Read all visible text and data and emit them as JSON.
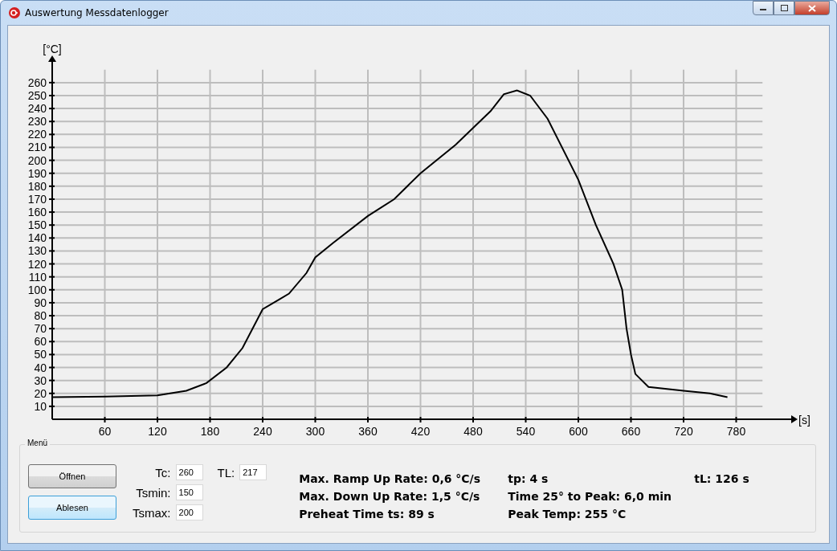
{
  "window": {
    "title": "Auswertung Messdatenlogger"
  },
  "chart": {
    "chart_data": {
      "type": "line",
      "grid": true,
      "xlabel": "[s]",
      "ylabel": "[°C]",
      "xlim": [
        0,
        810
      ],
      "ylim": [
        0,
        270
      ],
      "xticks": [
        60,
        120,
        180,
        240,
        300,
        360,
        420,
        480,
        540,
        600,
        660,
        720,
        780
      ],
      "yticks": [
        10,
        20,
        30,
        40,
        50,
        60,
        70,
        80,
        90,
        100,
        110,
        120,
        130,
        140,
        150,
        160,
        170,
        180,
        190,
        200,
        210,
        220,
        230,
        240,
        250,
        260
      ],
      "x": [
        0,
        60,
        120,
        153,
        176,
        199,
        217,
        240,
        260,
        270,
        290,
        300,
        320,
        360,
        390,
        420,
        460,
        480,
        500,
        515,
        530,
        545,
        565,
        600,
        620,
        640,
        650,
        655,
        660,
        665,
        680,
        720,
        750,
        770
      ],
      "series": [
        {
          "color": "#000000",
          "values": [
            17,
            17.5,
            18.5,
            22,
            28,
            40,
            55,
            85,
            93,
            97,
            113,
            125,
            136,
            157,
            170,
            190,
            212,
            225,
            238,
            251,
            254,
            250,
            232,
            185,
            150,
            120,
            100,
            70,
            50,
            35,
            25,
            22,
            20,
            17
          ]
        }
      ]
    }
  },
  "menu": {
    "title": "Menü",
    "buttons": [
      {
        "label": "Öffnen",
        "focused": false
      },
      {
        "label": "Ablesen",
        "focused": true
      }
    ],
    "field_columns": [
      [
        {
          "label": "Tc:",
          "value": "260"
        },
        {
          "label": "Tsmin:",
          "value": "150"
        },
        {
          "label": "Tsmax:",
          "value": "200"
        }
      ],
      [
        {
          "label": "TL:",
          "value": "217"
        }
      ]
    ],
    "result_columns": [
      [
        "Max. Ramp Up Rate: 0,6 °C/s",
        "Max. Down Up Rate: 1,5 °C/s",
        "Preheat Time ts: 89 s"
      ],
      [
        "tp: 4 s",
        "Time 25° to Peak: 6,0 min",
        "Peak Temp: 255 °C"
      ],
      [
        "tL: 126 s"
      ]
    ]
  }
}
